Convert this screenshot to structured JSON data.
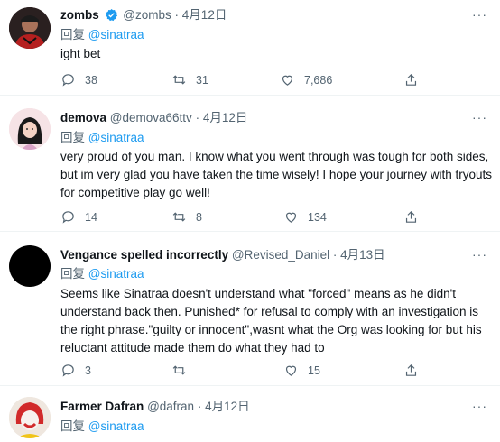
{
  "tweets": [
    {
      "name": "zombs",
      "handle": "@zombs",
      "date": "4月12日",
      "reply_prefix": "回复",
      "reply_to": "@sinatraa",
      "text": "ight bet",
      "replies": "38",
      "retweets": "31",
      "likes": "7,686",
      "verified": true
    },
    {
      "name": "demova",
      "handle": "@demova66ttv",
      "date": "4月12日",
      "reply_prefix": "回复",
      "reply_to": "@sinatraa",
      "text": "very proud of you man. I know what you went through was tough for both sides, but im very glad you have taken the time wisely! I hope your journey with tryouts for competitive play go well!",
      "replies": "14",
      "retweets": "8",
      "likes": "134"
    },
    {
      "name": "Vengance spelled incorrectly",
      "handle": "@Revised_Daniel",
      "date": "4月13日",
      "reply_prefix": "回复",
      "reply_to": "@sinatraa",
      "text": "Seems like Sinatraa doesn't understand what \"forced\" means as he didn't understand back then. Punished* for refusal to comply with an investigation is the right phrase.\"guilty or innocent\",wasnt what the Org was looking for but his reluctant attitude made them do what they had to",
      "replies": "3",
      "retweets": "",
      "likes": "15"
    },
    {
      "name": "Farmer Dafran",
      "handle": "@dafran",
      "date": "4月12日",
      "reply_prefix": "回复",
      "reply_to": "@sinatraa",
      "text": "",
      "replies": "",
      "retweets": "",
      "likes": ""
    }
  ],
  "separator": "·",
  "more_label": "···",
  "colors": {
    "accent": "#1d9bf0",
    "muted": "#536471",
    "text": "#0f1419"
  }
}
